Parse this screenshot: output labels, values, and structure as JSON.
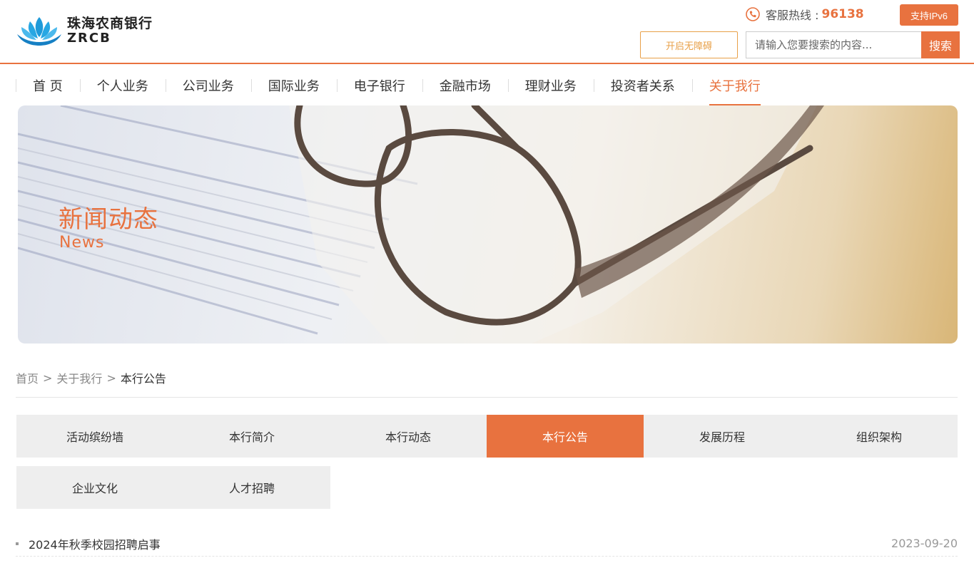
{
  "brand": {
    "logo_cn": "珠海农商银行",
    "logo_en": "ZRCB",
    "accent_color": "#e8723f"
  },
  "header": {
    "hotline_label": "客服热线 :",
    "hotline_number": "96138",
    "ipv6_label": "支持IPv6",
    "accessibility_label": "开启无障碍",
    "search_placeholder": "请输入您要搜索的内容...",
    "search_button": "搜索"
  },
  "nav": {
    "items": [
      {
        "label": "首 页"
      },
      {
        "label": "个人业务"
      },
      {
        "label": "公司业务"
      },
      {
        "label": "国际业务"
      },
      {
        "label": "电子银行"
      },
      {
        "label": "金融市场"
      },
      {
        "label": "理财业务"
      },
      {
        "label": "投资者关系"
      },
      {
        "label": "关于我行"
      }
    ],
    "active_index": 8
  },
  "banner": {
    "title": "新闻动态",
    "subtitle": "News"
  },
  "breadcrumb": {
    "items": [
      "首页",
      "关于我行",
      "本行公告"
    ],
    "separator": ">"
  },
  "tabs": {
    "items": [
      {
        "label": "活动缤纷墙"
      },
      {
        "label": "本行简介"
      },
      {
        "label": "本行动态"
      },
      {
        "label": "本行公告"
      },
      {
        "label": "发展历程"
      },
      {
        "label": "组织架构"
      },
      {
        "label": "企业文化"
      },
      {
        "label": "人才招聘"
      }
    ],
    "active_index": 3
  },
  "notices": [
    {
      "title": "2024年秋季校园招聘启事",
      "date": "2023-09-20"
    }
  ]
}
